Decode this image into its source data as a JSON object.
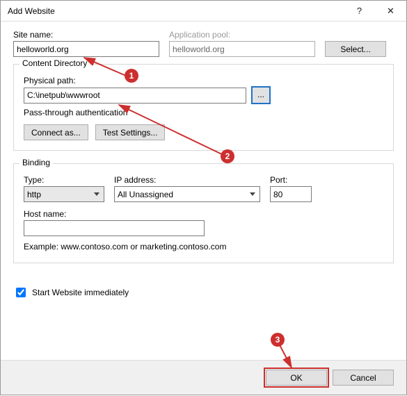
{
  "titlebar": {
    "title": "Add Website",
    "help": "?",
    "close": "✕"
  },
  "site_name": {
    "label": "Site name:",
    "value": "helloworld.org"
  },
  "app_pool": {
    "label": "Application pool:",
    "value": "helloworld.org",
    "select_label": "Select..."
  },
  "content_dir": {
    "legend": "Content Directory",
    "physical_path_label": "Physical path:",
    "physical_path_value": "C:\\inetpub\\wwwroot",
    "browse": "...",
    "passthrough": "Pass-through authentication",
    "connect_as": "Connect as...",
    "test_settings": "Test Settings..."
  },
  "binding": {
    "legend": "Binding",
    "type_label": "Type:",
    "type_value": "http",
    "ip_label": "IP address:",
    "ip_value": "All Unassigned",
    "port_label": "Port:",
    "port_value": "80",
    "host_label": "Host name:",
    "host_value": "",
    "example": "Example: www.contoso.com or marketing.contoso.com"
  },
  "start_immediately": {
    "label": "Start Website immediately",
    "checked": true
  },
  "footer": {
    "ok": "OK",
    "cancel": "Cancel"
  },
  "annotations": {
    "b1": "1",
    "b2": "2",
    "b3": "3"
  }
}
